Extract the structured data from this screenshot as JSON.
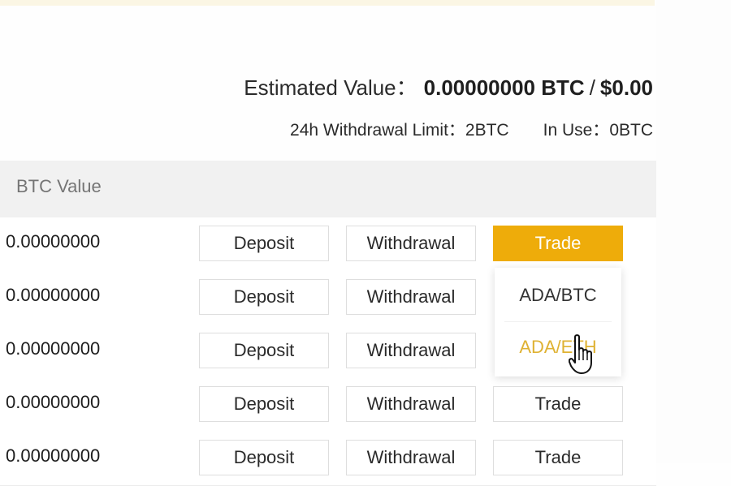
{
  "summary": {
    "estimated_label": "Estimated Value：",
    "btc_value": "0.00000000 BTC",
    "separator": "/",
    "usd_value": "$0.00",
    "withdrawal_limit_label": "24h Withdrawal Limit：",
    "withdrawal_limit_value": "2BTC",
    "in_use_label": "In Use：",
    "in_use_value": "0BTC"
  },
  "table": {
    "header": {
      "btc_value": "BTC Value"
    },
    "rows": [
      {
        "btc_value": "0.00000000",
        "deposit": "Deposit",
        "withdrawal": "Withdrawal",
        "trade": "Trade"
      },
      {
        "btc_value": "0.00000000",
        "deposit": "Deposit",
        "withdrawal": "Withdrawal",
        "trade": ""
      },
      {
        "btc_value": "0.00000000",
        "deposit": "Deposit",
        "withdrawal": "Withdrawal",
        "trade": ""
      },
      {
        "btc_value": "0.00000000",
        "deposit": "Deposit",
        "withdrawal": "Withdrawal",
        "trade": "Trade"
      },
      {
        "btc_value": "0.00000000",
        "deposit": "Deposit",
        "withdrawal": "Withdrawal",
        "trade": "Trade"
      }
    ]
  },
  "trade_dropdown": {
    "options": [
      "ADA/BTC",
      "ADA/ETH"
    ],
    "hovered_option": "ADA/ETH"
  },
  "colors": {
    "accent": "#eeac0a",
    "hover_text": "#dfb233",
    "header_bg": "#f1f1f1"
  },
  "icons": {
    "cursor": "hand-pointer-icon"
  }
}
